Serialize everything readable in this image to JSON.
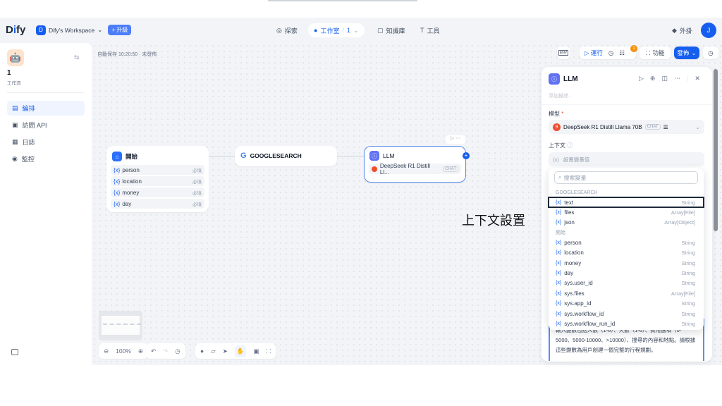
{
  "header": {
    "logo": "Dify",
    "workspace_initial": "D",
    "workspace": "Dify's Workspace",
    "upgrade": "+ 升級",
    "nav": [
      {
        "label": "探索"
      },
      {
        "label": "工作室",
        "count": "1"
      },
      {
        "label": "知識庫"
      },
      {
        "label": "工具"
      }
    ],
    "plugins": "外掛",
    "user_initial": "J"
  },
  "sidebar": {
    "app_name": "1",
    "app_type": "工作流",
    "items": [
      {
        "label": "編排"
      },
      {
        "label": "訪問 API"
      },
      {
        "label": "日誌"
      },
      {
        "label": "監控"
      }
    ]
  },
  "canvas": {
    "autosave": "自動保存 10:20:50 · 未發佈",
    "toolbar": {
      "env": "ENV",
      "run": "運行",
      "features": "功能",
      "publish": "發佈",
      "badge": "1"
    },
    "start_node": {
      "title": "開始",
      "vars": [
        {
          "name": "person",
          "req": "必填"
        },
        {
          "name": "location",
          "req": "必填"
        },
        {
          "name": "money",
          "req": "必填"
        },
        {
          "name": "day",
          "req": "必填"
        }
      ]
    },
    "google_node": {
      "title": "GOOGLESEARCH"
    },
    "llm_node": {
      "title": "LLM",
      "model": "DeepSeek R1 Distill Ll...",
      "mode": "CHAT"
    },
    "zoom": "100%",
    "annotation": "上下文設置"
  },
  "panel": {
    "title": "LLM",
    "desc_placeholder": "添加描述...",
    "model_label": "模型",
    "required": "*",
    "model": "DeepSeek R1 Distill Llama 70B",
    "model_badge_icon": "9",
    "mode": "CHAT",
    "context_label": "上下文",
    "context_placeholder": "設置變量值",
    "search_placeholder": "搜索變量",
    "groups": [
      {
        "name": "GOOGLESEARCH",
        "vars": [
          {
            "name": "text",
            "type": "String"
          },
          {
            "name": "files",
            "type": "Array[File]"
          },
          {
            "name": "json",
            "type": "Array[Object]"
          }
        ]
      },
      {
        "name": "開始",
        "vars": [
          {
            "name": "person",
            "type": "String"
          },
          {
            "name": "location",
            "type": "String"
          },
          {
            "name": "money",
            "type": "String"
          },
          {
            "name": "day",
            "type": "String"
          },
          {
            "name": "sys.user_id",
            "type": "String"
          },
          {
            "name": "sys.files",
            "type": "Array[File]"
          },
          {
            "name": "sys.app_id",
            "type": "String"
          },
          {
            "name": "sys.workflow_id",
            "type": "String"
          },
          {
            "name": "sys.workflow_run_id",
            "type": "String"
          }
        ]
      }
    ],
    "prompt_text": "輸入變數包括人數（1-6）、天數（1-6）、費用選項（0-5000、5000-10000、>10000）、搜尋的內容和地點。請根據這些變數為用戶創建一個完整的行程規劃。"
  },
  "colors": {
    "accent": "#155eef",
    "bg": "#f2f4f7",
    "model_icon": "#ef4d2f"
  }
}
